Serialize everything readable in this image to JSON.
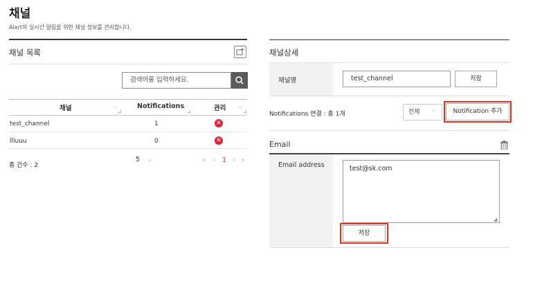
{
  "page": {
    "title": "채널",
    "subtitle": "Alert의 실시간 알림을 위한 채널 정보를 관리합니다."
  },
  "channel_list": {
    "header": "채널 목록",
    "search_placeholder": "검색어를 입력하세요.",
    "columns": [
      "채널",
      "Notifications",
      "관리"
    ],
    "rows": [
      {
        "name": "test_channel",
        "notifications": "1"
      },
      {
        "name": "llluuu",
        "notifications": "0"
      }
    ],
    "total": "총 건수 : 2",
    "page_size": "5",
    "pager": {
      "first": "«",
      "prev": "‹",
      "current": "1",
      "next": "›",
      "last": "»"
    },
    "colors": {
      "delete": "#e0233b",
      "current_page": "#e0233b"
    }
  },
  "channel_detail": {
    "header": "채널상세",
    "name_label": "채널명",
    "name_value": "test_channel",
    "save_label": "저장",
    "notif_label": "Notifications 연결 : 총 1개",
    "filter_value": "전체",
    "add_notif_label": "Notification 추가",
    "email_title": "Email",
    "email_label": "Email address",
    "email_value": "test@sk.com",
    "email_save_label": "저장",
    "highlight_color": "#e0331f"
  },
  "icons": [
    "add-channel-icon",
    "search-icon",
    "delete-icon",
    "chevron-down-icon",
    "trash-icon"
  ]
}
